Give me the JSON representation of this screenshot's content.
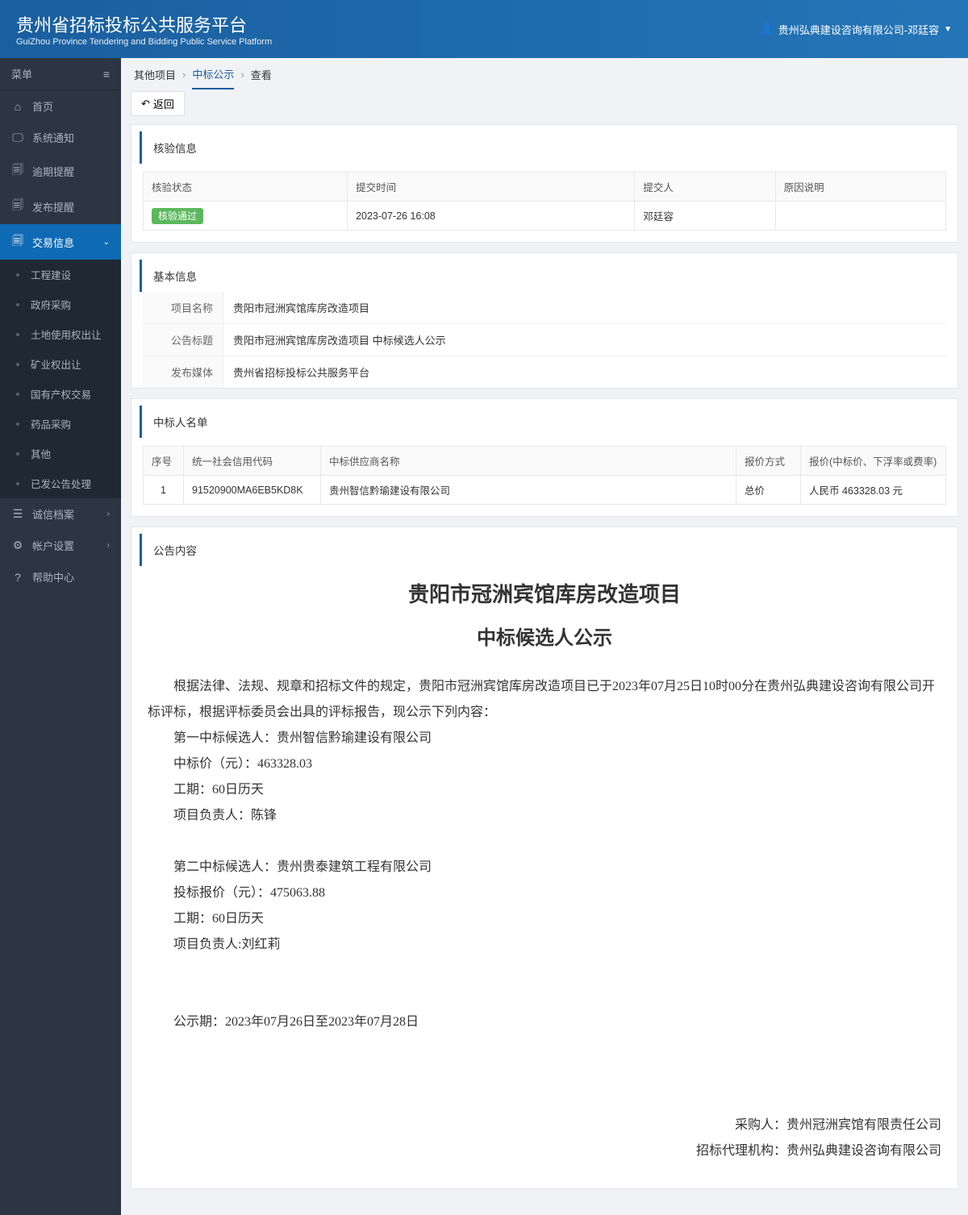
{
  "header": {
    "title_cn": "贵州省招标投标公共服务平台",
    "title_en": "GuiZhou Province Tendering and Bidding Public Service Platform",
    "user": "贵州弘典建设咨询有限公司-邓廷容"
  },
  "sidebar": {
    "menu_label": "菜单",
    "items": [
      {
        "icon": "⌂",
        "label": "首页"
      },
      {
        "icon": "🖵",
        "label": "系统通知"
      },
      {
        "icon": "🗐",
        "label": "逾期提醒"
      },
      {
        "icon": "🗐",
        "label": "发布提醒"
      },
      {
        "icon": "🗐",
        "label": "交易信息",
        "active": true
      },
      {
        "icon": "☰",
        "label": "诚信档案"
      },
      {
        "icon": "⚙",
        "label": "帐户设置"
      },
      {
        "icon": "?",
        "label": "帮助中心"
      }
    ],
    "sub_items": [
      "工程建设",
      "政府采购",
      "土地使用权出让",
      "矿业权出让",
      "国有产权交易",
      "药品采购",
      "其他",
      "已发公告处理"
    ]
  },
  "breadcrumb": [
    "其他项目",
    "中标公示",
    "查看"
  ],
  "back_label": "返回",
  "panels": {
    "verify": {
      "title": "核验信息",
      "headers": [
        "核验状态",
        "提交时间",
        "提交人",
        "原因说明"
      ],
      "row": {
        "status": "核验通过",
        "time": "2023-07-26 16:08",
        "person": "邓廷容",
        "reason": ""
      }
    },
    "basic": {
      "title": "基本信息",
      "rows": [
        {
          "label": "项目名称",
          "value": "贵阳市冠洲宾馆库房改造项目"
        },
        {
          "label": "公告标题",
          "value": "贵阳市冠洲宾馆库房改造项目 中标候选人公示"
        },
        {
          "label": "发布媒体",
          "value": "贵州省招标投标公共服务平台"
        }
      ]
    },
    "winners": {
      "title": "中标人名单",
      "headers": [
        "序号",
        "统一社会信用代码",
        "中标供应商名称",
        "报价方式",
        "报价(中标价、下浮率或费率)"
      ],
      "rows": [
        {
          "no": "1",
          "code": "91520900MA6EB5KD8K",
          "name": "贵州智信黔瑜建设有限公司",
          "method": "总价",
          "price": "人民币 463328.03 元"
        }
      ]
    },
    "content": {
      "title": "公告内容",
      "h1": "贵阳市冠洲宾馆库房改造项目",
      "h2": "中标候选人公示",
      "intro": "根据法律、法规、规章和招标文件的规定，贵阳市冠洲宾馆库房改造项目已于2023年07月25日10时00分在贵州弘典建设咨询有限公司开标评标，根据评标委员会出具的评标报告，现公示下列内容：",
      "c1": {
        "line1": "第一中标候选人：贵州智信黔瑜建设有限公司",
        "line2": "中标价（元）：463328.03",
        "line3": "工期：60日历天",
        "line4": "项目负责人：陈锋"
      },
      "c2": {
        "line1": "第二中标候选人：贵州贵泰建筑工程有限公司",
        "line2": "投标报价（元）：475063.88",
        "line3": "工期：60日历天",
        "line4": "项目负责人:刘红莉"
      },
      "period": "公示期：2023年07月26日至2023年07月28日",
      "buyer": "采购人：贵州冠洲宾馆有限责任公司",
      "agent": "招标代理机构：贵州弘典建设咨询有限公司"
    }
  }
}
